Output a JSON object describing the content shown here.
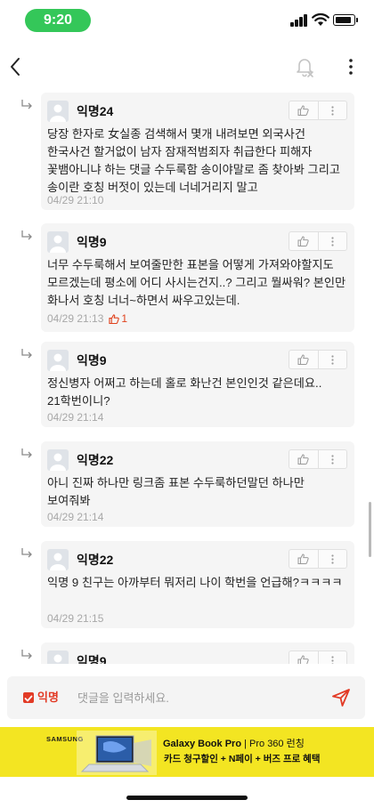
{
  "status_bar": {
    "time": "9:20"
  },
  "comment_input": {
    "anon_label": "익명",
    "placeholder": "댓글을 입력하세요."
  },
  "comments": [
    {
      "nickname": "익명24",
      "text": "당장 한자로 女실종 검색해서 몇개 내려보면 외국사건 한국사건 할거없이 남자 잠재적범죄자 취급한다 피해자 꽃뱀아니냐 하는 댓글 수두룩함 송이야말로 좀 찾아봐 그리고 송이란 호칭 버젓이 있는데 너네거리지 말고",
      "time": "04/29 21:10",
      "likes": null
    },
    {
      "nickname": "익명9",
      "text": "너무 수두룩해서 보여줄만한 표본을 어떻게 가져와야할지도 모르겠는데 평소에 어디 사시는건지..? 그리고 뭘싸워? 본인만 화나서 호칭 너너~하면서 싸우고있는데.",
      "time": "04/29 21:13",
      "likes": "1"
    },
    {
      "nickname": "익명9",
      "text": "정신병자 어쩌고 하는데 홀로 화난건 본인인것 같은데요.. 21학번이니?",
      "time": "04/29 21:14",
      "likes": null
    },
    {
      "nickname": "익명22",
      "text": "아니 진짜 하나만 링크좀 표본 수두룩하던말던 하나만 보여줘봐",
      "time": "04/29 21:14",
      "likes": null
    },
    {
      "nickname": "익명22",
      "text": "익명 9 친구는 아까부터 뭐저리 나이 학번을 언급해?ㅋㅋㅋㅋ",
      "time": "04/29 21:15",
      "likes": null
    },
    {
      "nickname": "익명9",
      "text": "",
      "time": "",
      "likes": null
    }
  ],
  "ad": {
    "brand": "SAMSUNG",
    "headline_bold": "Galaxy Book Pro",
    "headline_rest": " | Pro 360 런칭",
    "subline": "카드 청구할인 + N페이 + 버즈 프로 혜택"
  },
  "colors": {
    "status_green": "#34c759",
    "accent_red": "#e23a25",
    "ad_yellow": "#f3e522",
    "card_bg": "#f5f5f5"
  },
  "icons": [
    "back-arrow-icon",
    "notification-off-icon",
    "more-vertical-icon",
    "reply-arrow-icon",
    "thumbs-up-icon",
    "kebab-menu-icon",
    "send-icon"
  ]
}
